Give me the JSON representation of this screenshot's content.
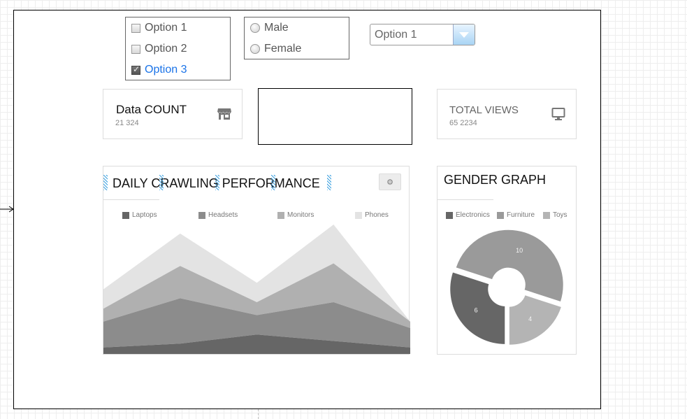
{
  "checkbox_group": {
    "items": [
      {
        "label": "Option 1",
        "checked": false
      },
      {
        "label": "Option 2",
        "checked": false
      },
      {
        "label": "Option 3",
        "checked": true
      }
    ]
  },
  "radio_group": {
    "items": [
      {
        "label": "Male",
        "selected": false
      },
      {
        "label": "Female",
        "selected": false
      }
    ]
  },
  "dropdown": {
    "value": "Option 1"
  },
  "stat_cards": [
    {
      "title": "Data COUNT",
      "value": "21 324",
      "icon": "store-icon"
    },
    {
      "title": "TOTAL VIEWS",
      "value": "65 2234",
      "icon": "monitor-icon"
    }
  ],
  "daily_panel": {
    "title": "DAILY CRAWLING PERFORMANCE",
    "settings_icon": "gear-icon"
  },
  "gender_panel": {
    "title": "GENDER GRAPH"
  },
  "chart_data": [
    {
      "type": "area",
      "stacked": true,
      "title": "DAILY CRAWLING PERFORMANCE",
      "x": [
        0,
        1,
        2,
        3,
        4
      ],
      "ylim": [
        0,
        100
      ],
      "legend_position": "top",
      "grid": false,
      "series": [
        {
          "name": "Laptops",
          "values": [
            5,
            8,
            15,
            10,
            5
          ],
          "color": "#666666"
        },
        {
          "name": "Headsets",
          "values": [
            20,
            35,
            15,
            30,
            15
          ],
          "color": "#8c8c8c"
        },
        {
          "name": "Monitors",
          "values": [
            10,
            25,
            10,
            30,
            5
          ],
          "color": "#b0b0b0"
        },
        {
          "name": "Phones",
          "values": [
            15,
            25,
            15,
            30,
            0
          ],
          "color": "#e3e3e3"
        }
      ]
    },
    {
      "type": "pie",
      "donut": true,
      "title": "GENDER GRAPH",
      "legend_position": "top",
      "categories": [
        "Electronics",
        "Furniture",
        "Toys"
      ],
      "values": [
        6,
        10,
        4
      ],
      "colors": [
        "#666666",
        "#9a9a9a",
        "#b4b4b4"
      ]
    }
  ]
}
